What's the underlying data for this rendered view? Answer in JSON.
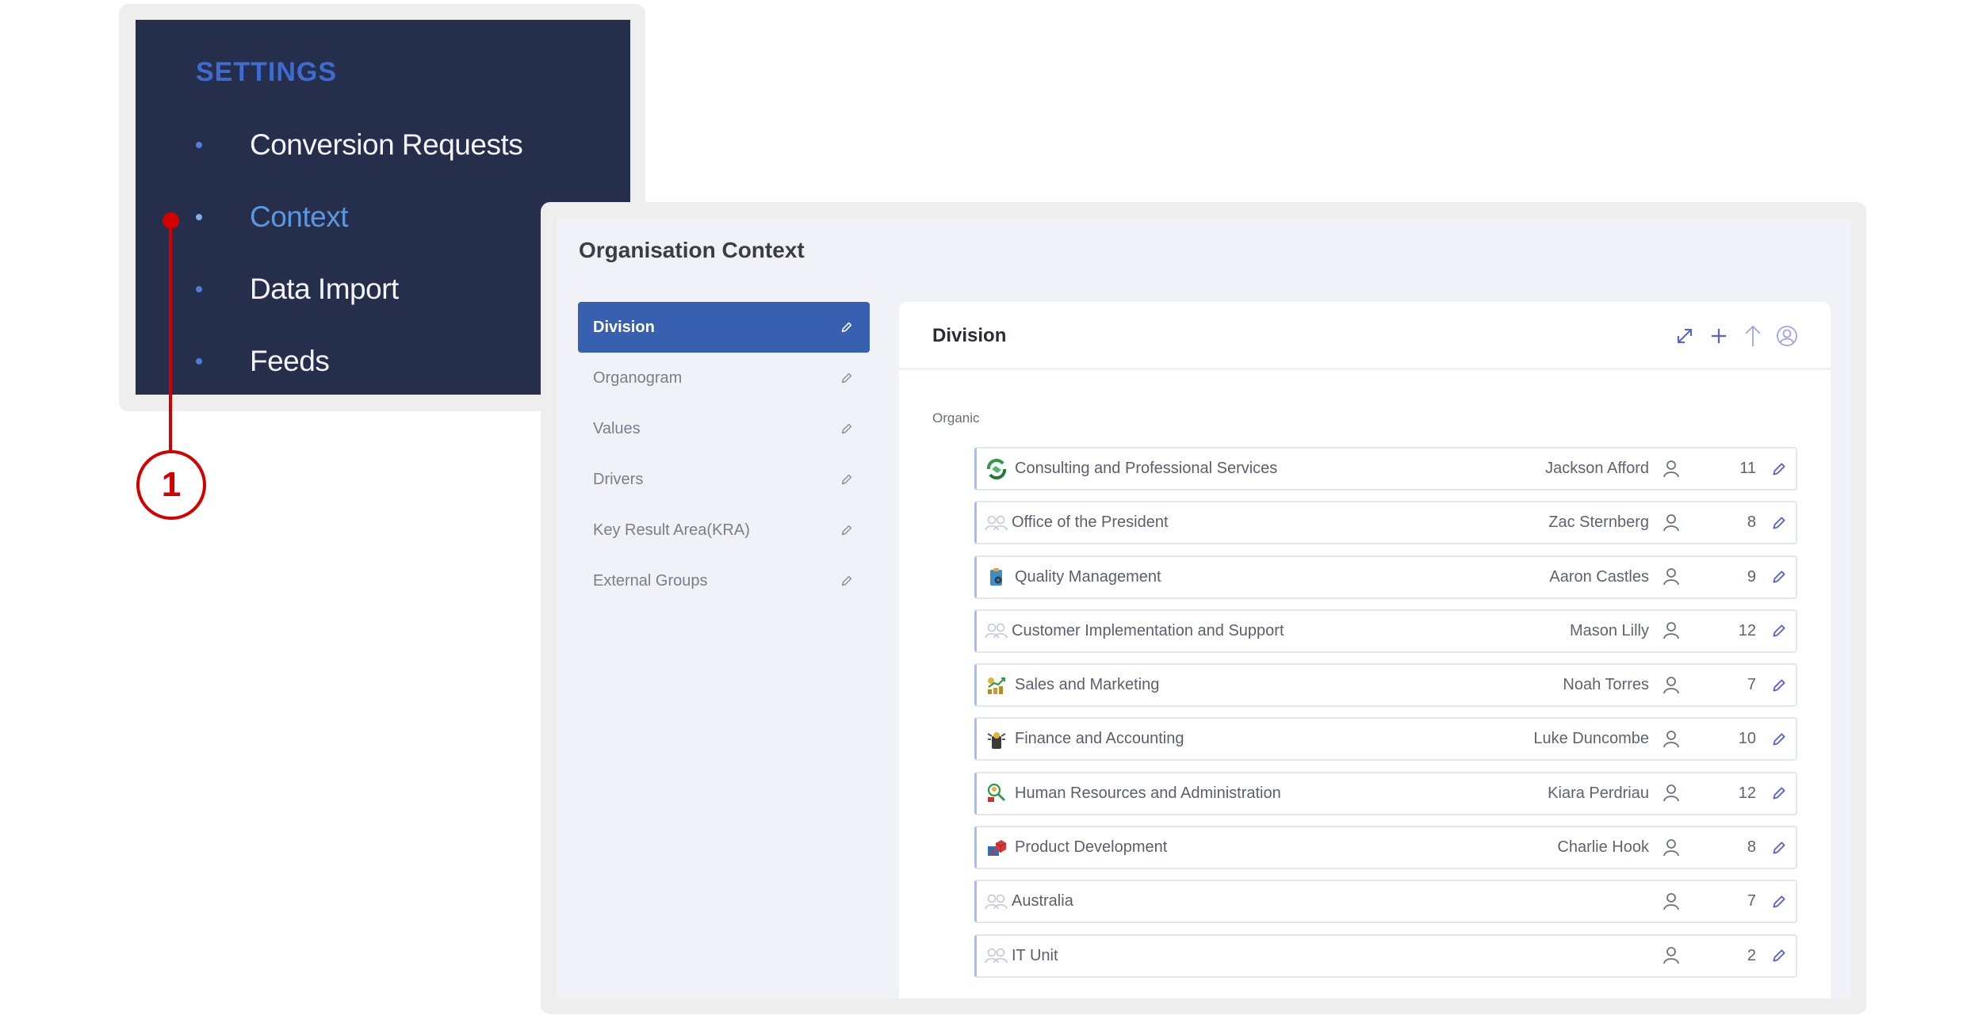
{
  "sidebar": {
    "heading": "SETTINGS",
    "items": [
      {
        "label": "Conversion Requests",
        "active": false
      },
      {
        "label": "Context",
        "active": true
      },
      {
        "label": "Data Import",
        "active": false
      },
      {
        "label": "Feeds",
        "active": false
      }
    ]
  },
  "annotation": {
    "number": "1"
  },
  "page": {
    "title": "Organisation Context"
  },
  "left_menu": {
    "items": [
      {
        "label": "Division",
        "active": true,
        "icon": "pencil-icon"
      },
      {
        "label": "Organogram",
        "active": false,
        "icon": "pencil-icon"
      },
      {
        "label": "Values",
        "active": false,
        "icon": "pencil-icon"
      },
      {
        "label": "Drivers",
        "active": false,
        "icon": "pencil-icon"
      },
      {
        "label": "Key Result Area(KRA)",
        "active": false,
        "icon": "pencil-icon"
      },
      {
        "label": "External Groups",
        "active": false,
        "icon": "pencil-icon"
      }
    ]
  },
  "content": {
    "title": "Division",
    "header_icons": [
      "expand-icon",
      "plus-icon",
      "arrow-up-icon",
      "user-circle-icon"
    ],
    "group_label": "Organic",
    "rows": [
      {
        "name": "Consulting and Professional Services",
        "owner": "Jackson Afford",
        "count": "11",
        "icon": "handshake-icon"
      },
      {
        "name": "Office of the President",
        "owner": "Zac Sternberg",
        "count": "8",
        "icon": "group-icon"
      },
      {
        "name": "Quality Management",
        "owner": "Aaron Castles",
        "count": "9",
        "icon": "clipboard-gear-icon"
      },
      {
        "name": "Customer Implementation and Support",
        "owner": "Mason Lilly",
        "count": "12",
        "icon": "group-icon"
      },
      {
        "name": "Sales and Marketing",
        "owner": "Noah Torres",
        "count": "7",
        "icon": "sales-chart-icon"
      },
      {
        "name": "Finance and Accounting",
        "owner": "Luke Duncombe",
        "count": "10",
        "icon": "finance-icon"
      },
      {
        "name": "Human Resources and Administration",
        "owner": "Kiara Perdriau",
        "count": "12",
        "icon": "hr-search-icon"
      },
      {
        "name": "Product Development",
        "owner": "Charlie Hook",
        "count": "8",
        "icon": "product-box-icon"
      },
      {
        "name": "Australia",
        "owner": "",
        "count": "7",
        "icon": "group-icon"
      },
      {
        "name": "IT Unit",
        "owner": "",
        "count": "2",
        "icon": "group-icon"
      }
    ]
  },
  "colors": {
    "sidebar_bg": "#252f4b",
    "sidebar_heading": "#3f6bd0",
    "sidebar_active": "#5b97de",
    "accent": "#3760b0",
    "annotation": "#d40000",
    "row_accent": "#a9bdf2",
    "icon_blue": "#5b63d8"
  }
}
